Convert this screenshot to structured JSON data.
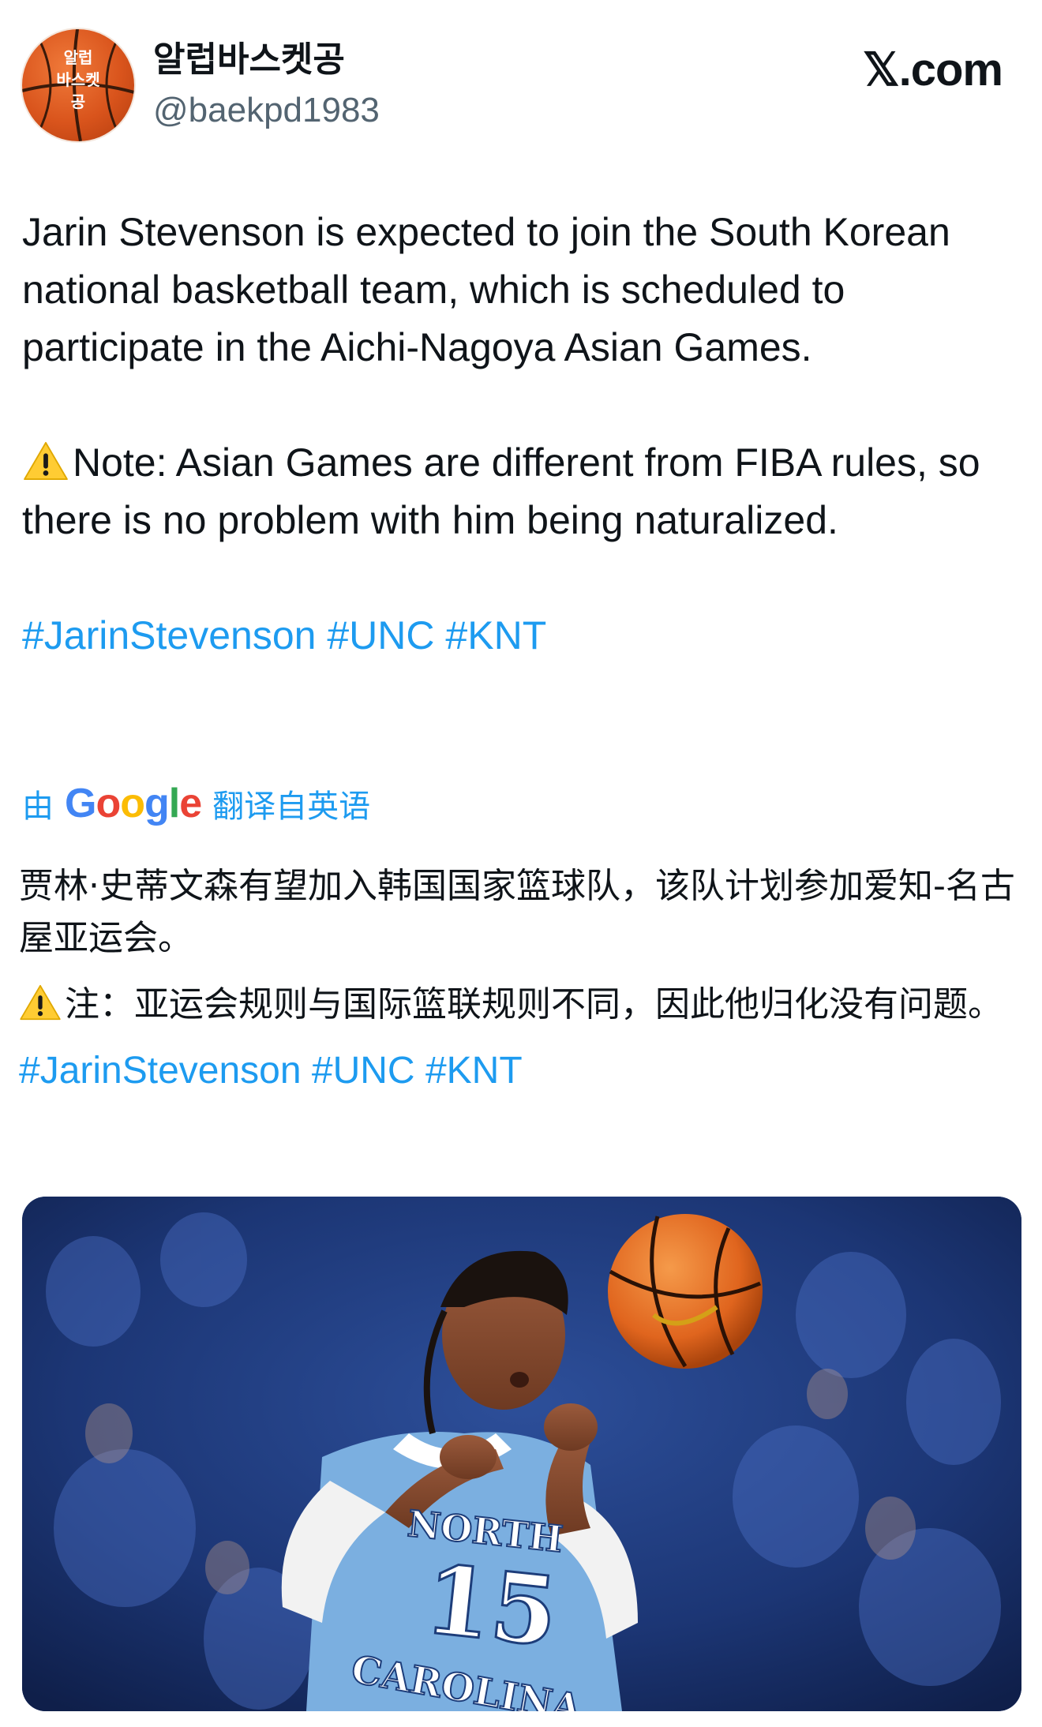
{
  "author": {
    "avatar_text": [
      "알럽",
      "바스켓",
      "공"
    ],
    "display_name": "알럽바스켓공",
    "handle": "@baekpd1983"
  },
  "brand": "𝕏.com",
  "tweet": {
    "paragraph_1": "Jarin Stevenson is expected to join the South Korean national basketball team, which is scheduled to participate in the Aichi-Nagoya Asian Games.",
    "paragraph_2": "Note: Asian Games are different from FIBA rules, so there is no problem with him being naturalized.",
    "hashtags": [
      "#JarinStevenson",
      "#UNC",
      "#KNT"
    ]
  },
  "translation": {
    "prefix": "由",
    "provider": "Google",
    "suffix": "翻译自英语",
    "paragraph_1": "贾林·史蒂文森有望加入韩国国家篮球队，该队计划参加爱知-名古屋亚运会。",
    "paragraph_2": "注：亚运会规则与国际篮联规则不同，因此他归化没有问题。",
    "hashtags": [
      "#JarinStevenson",
      "#UNC",
      "#KNT"
    ]
  },
  "media": {
    "jersey_line_1": "NORTH",
    "jersey_number": "15",
    "jersey_line_2": "CAROLINA"
  },
  "icons": {
    "warning": "warning-icon"
  },
  "colors": {
    "link": "#1d9bf0",
    "text": "#0f1419",
    "secondary": "#536471",
    "jersey": "#7bafe0"
  }
}
